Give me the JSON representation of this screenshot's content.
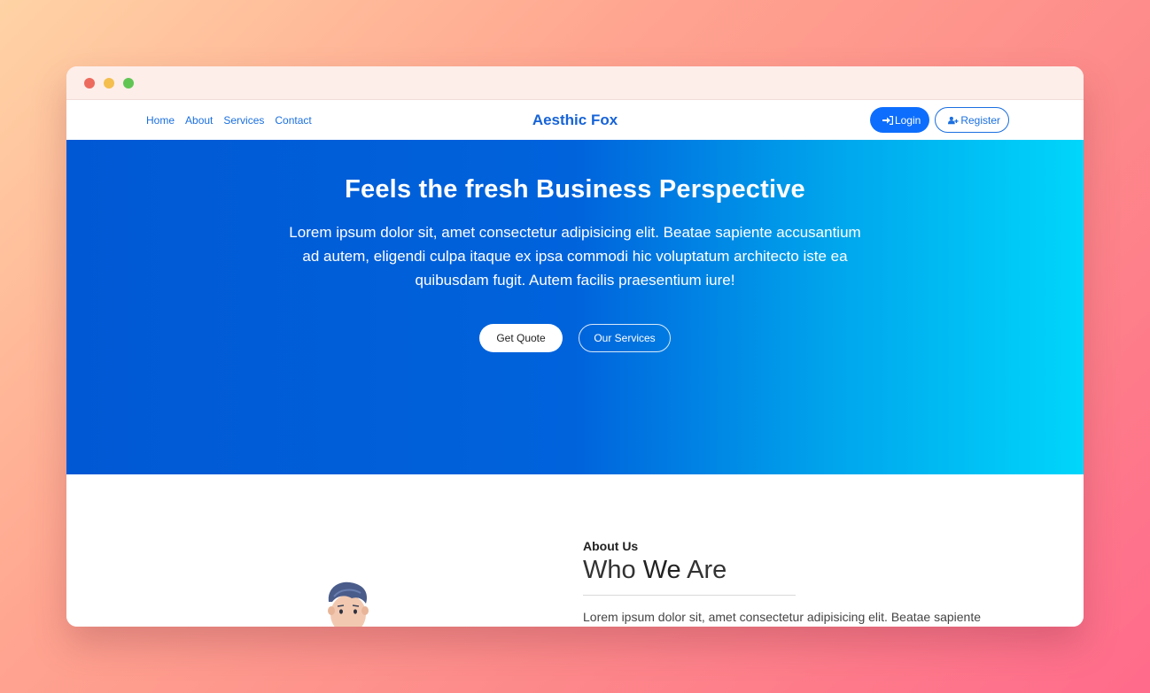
{
  "nav": {
    "links": [
      "Home",
      "About",
      "Services",
      "Contact"
    ],
    "brand": "Aesthic Fox",
    "login_label": "Login",
    "register_label": "Register"
  },
  "hero": {
    "title": "Feels the fresh Business Perspective",
    "paragraph": "Lorem ipsum dolor sit, amet consectetur adipisicing elit. Beatae sapiente accusantium ad autem, eligendi culpa itaque ex ipsa commodi hic voluptatum architecto iste ea quibusdam fugit. Autem facilis praesentium iure!",
    "primary_button": "Get Quote",
    "secondary_button": "Our Services"
  },
  "about": {
    "eyebrow": "About Us",
    "heading_prefix": "Who ",
    "heading_emphasis": "We",
    "heading_suffix": " Are",
    "paragraph": "Lorem ipsum dolor sit, amet consectetur adipisicing elit. Beatae sapiente"
  },
  "colors": {
    "brand_blue": "#1663d8",
    "button_blue": "#0d6efd",
    "hero_gradient_start": "#0158d4",
    "hero_gradient_end": "#00d6fb"
  },
  "icons": {
    "login": "sign-in-icon",
    "register": "user-plus-icon"
  }
}
